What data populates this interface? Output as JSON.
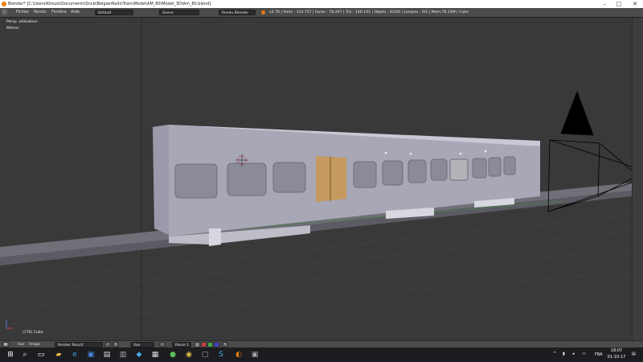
{
  "titlebar": {
    "title": "Blender* [C:\\Users\\Khouis\\Documents\\Sncb\\BelgianRails\\Train\\Model\\AM_80\\Model_3D\\Am_80.blend]"
  },
  "menubar": {
    "items": [
      "Fichier",
      "Rendu",
      "Fenêtre",
      "Aide"
    ],
    "screen_layout": "Default",
    "scene": "Scene",
    "render_engine": "Rendu Blender",
    "stats": "v2.78 | Verts : 114.757 | Faces : 78.297 | Tris : 146.192 | Objets : 0/246 | Lampes : 0/1 | Mem:76.24M | Cube"
  },
  "viewport": {
    "view_name": "Persp. utilisateur",
    "units": "Mètres",
    "object_label": "(176) Cube"
  },
  "footer": {
    "menus": [
      "Vue",
      "Image"
    ],
    "image_name": "Render Result",
    "view_menu": "Vue",
    "frame_field": "Passe 1"
  },
  "taskbar": {
    "lang": "FRA",
    "time": "18:07",
    "date": "01-10-17"
  },
  "colors": {
    "viewport_bg": "#393939",
    "train_body": "#a6a6b4",
    "accent": "#e87d0d"
  }
}
